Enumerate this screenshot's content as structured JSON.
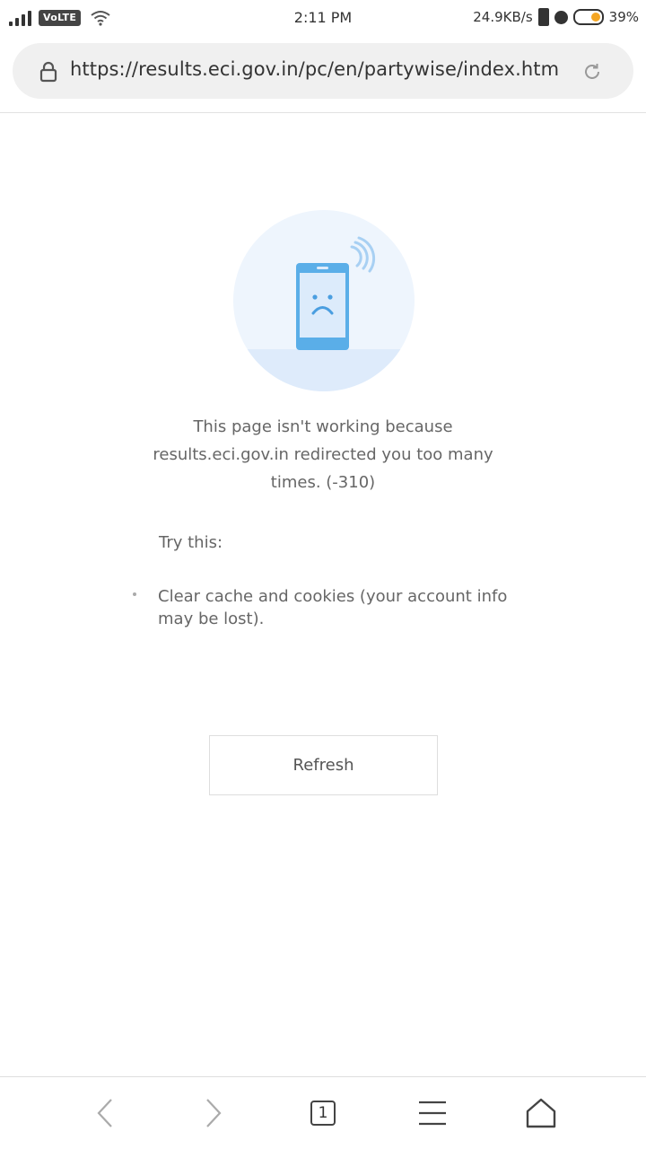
{
  "status_bar": {
    "network": "VoLTE",
    "time": "2:11 PM",
    "net_speed": "24.9KB/s",
    "battery_percent": "39%",
    "battery_level": 0.39
  },
  "address_bar": {
    "url": "https://results.eci.gov.in/pc/en/partywise/index.htm",
    "lock_icon": "lock-icon",
    "reload_icon": "reload-icon"
  },
  "error": {
    "illustration_icon": "sad-phone-icon",
    "message": "This page isn't working because results.eci.gov.in redirected you too many times. (-310)",
    "try_this_label": "Try this:",
    "suggestions": [
      "Clear cache and cookies (your account info may be lost)."
    ],
    "refresh_label": "Refresh"
  },
  "bottom_nav": {
    "back_icon": "back-arrow-icon",
    "forward_icon": "forward-arrow-icon",
    "tabs_count": "1",
    "menu_icon": "hamburger-menu-icon",
    "home_icon": "home-icon"
  },
  "colors": {
    "accent_blue": "#5aaee8",
    "illustration_bg": "#eaf3fd",
    "battery_orange": "#f5a623"
  }
}
